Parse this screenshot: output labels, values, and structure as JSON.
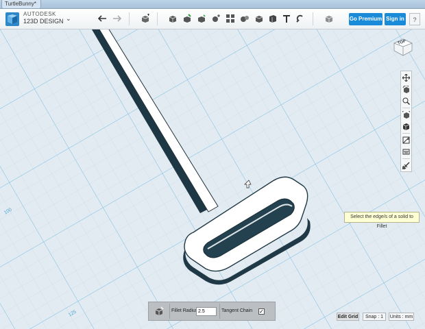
{
  "window": {
    "tab_title": "TurtleBunny*"
  },
  "brand": {
    "line1": "AUTODESK",
    "line2": "123D DESIGN"
  },
  "toolbar": {
    "undo_icon": "undo-icon",
    "redo_icon": "redo-icon",
    "tools": [
      "primitives-icon",
      "sketch-icon",
      "construct-icon",
      "modify-icon",
      "pattern-icon",
      "group-icon",
      "combine-icon",
      "measure-icon",
      "text-icon",
      "snap-icon",
      "material-icon"
    ]
  },
  "actions": {
    "premium": "Go Premium",
    "signin": "Sign in",
    "help": "?"
  },
  "viewcube": {
    "face": "TOP"
  },
  "grid_labels": {
    "left": "100",
    "bottom": "125"
  },
  "tooltip": {
    "text": "Select the edge/s of a solid to Fillet"
  },
  "fillet": {
    "radius_label": "Fillet Radius",
    "radius_value": "2.5",
    "chain_label": "Tangent Chain",
    "chain_checked": true
  },
  "status": {
    "edit_grid": "Edit Grid",
    "snap": "Snap : 1",
    "units": "Units : mm"
  }
}
